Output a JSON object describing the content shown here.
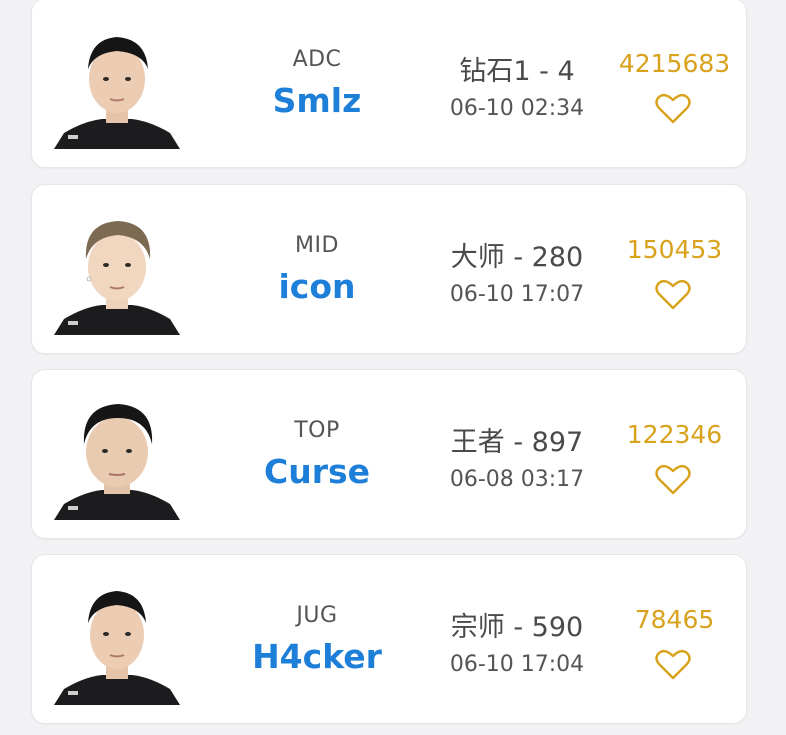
{
  "players": [
    {
      "role": "ADC",
      "name": "Smlz",
      "rank": "钻石1 - 4",
      "time": "06-10 02:34",
      "score": "4215683",
      "like_icon": "heart-outline-icon"
    },
    {
      "role": "MID",
      "name": "icon",
      "rank": "大师 - 280",
      "time": "06-10 17:07",
      "score": "150453",
      "like_icon": "heart-outline-icon"
    },
    {
      "role": "TOP",
      "name": "Curse",
      "rank": "王者 - 897",
      "time": "06-08 03:17",
      "score": "122346",
      "like_icon": "heart-outline-icon"
    },
    {
      "role": "JUG",
      "name": "H4cker",
      "rank": "宗师 - 590",
      "time": "06-10 17:04",
      "score": "78465",
      "like_icon": "heart-outline-icon"
    }
  ],
  "colors": {
    "name": "#1d7fd8",
    "score": "#d9a21d",
    "heart": "#d9a21d"
  }
}
